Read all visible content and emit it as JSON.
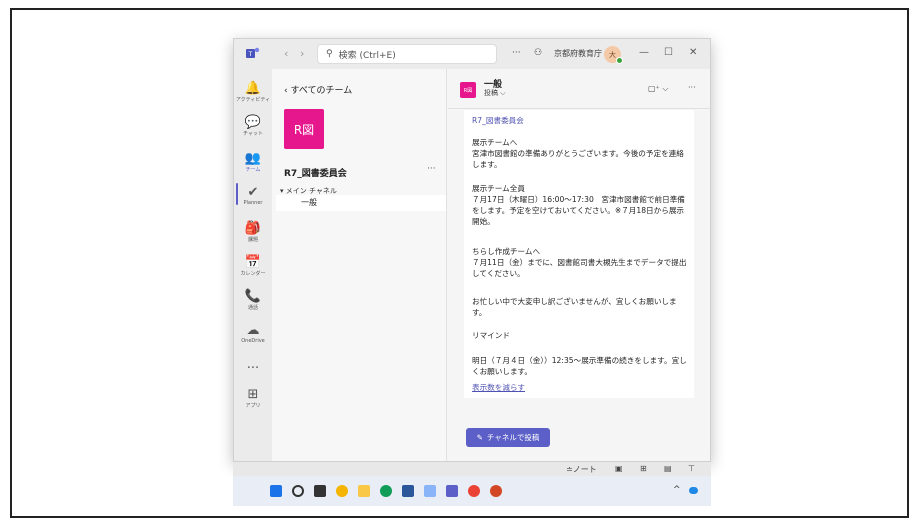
{
  "titlebar": {
    "nav_back": "‹",
    "nav_forward": "›",
    "search_placeholder": "検索 (Ctrl+E)",
    "more": "···",
    "org_name": "京都府教育庁",
    "avatar_initial": "大",
    "minimize": "—",
    "maximize": "☐",
    "close": "✕"
  },
  "rail": {
    "items": [
      {
        "label": "アクティビティ",
        "icon": "bell-icon",
        "glyph": "🔔"
      },
      {
        "label": "チャット",
        "icon": "chat-icon",
        "glyph": "💬"
      },
      {
        "label": "チーム",
        "icon": "teams-icon",
        "glyph": "👥"
      },
      {
        "label": "Planner",
        "icon": "planner-icon",
        "glyph": "✔"
      },
      {
        "label": "課題",
        "icon": "assignments-icon",
        "glyph": "🎒"
      },
      {
        "label": "カレンダー",
        "icon": "calendar-icon",
        "glyph": "📅"
      },
      {
        "label": "通話",
        "icon": "phone-icon",
        "glyph": "📞"
      },
      {
        "label": "OneDrive",
        "icon": "cloud-icon",
        "glyph": "☁"
      },
      {
        "label": "",
        "icon": "more-icon",
        "glyph": "···"
      },
      {
        "label": "アプリ",
        "icon": "apps-icon",
        "glyph": "⊞"
      }
    ]
  },
  "team_pane": {
    "back_label": "すべてのチーム",
    "tile_text": "R図",
    "team_name": "R7_図書委員会",
    "more": "···",
    "channel_group": "メイン チャネル",
    "channel_item": "一般"
  },
  "chat_header": {
    "tile_text": "R図",
    "channel_name": "一般",
    "tab_label": "投稿 ⌵",
    "video_label": "▢⁺ ⌵",
    "more": "···"
  },
  "message": {
    "mention": "R7_図書委員会",
    "p1": "展示チームへ\n宮津市図書館の準備ありがとうございます。今後の予定を連絡します。",
    "p2": "展示チーム全員\n７月17日（木曜日）16:00～17:30　宮津市図書館で前日準備をします。予定を空けておいてください。※７月18日から展示開始。",
    "p3": "ちらし作成チームへ\n７月11日（金）までに、図書館司書大槻先生までデータで提出してください。",
    "p4": "お忙しい中で大変申し訳ございませんが、宜しくお願いします。",
    "p5": "リマインド",
    "p6": "明日（７月４日（金））12:35～展示準備の続きをします。宜しくお願いします。",
    "link": "表示数を減らす"
  },
  "post_button": {
    "label": "チャネルで投稿"
  },
  "underbar": {
    "note": "≐ノート"
  },
  "taskbar": {
    "tray_caret": "^"
  },
  "colors": {
    "accent": "#5b5fc7",
    "team_tile": "#e6168c"
  }
}
